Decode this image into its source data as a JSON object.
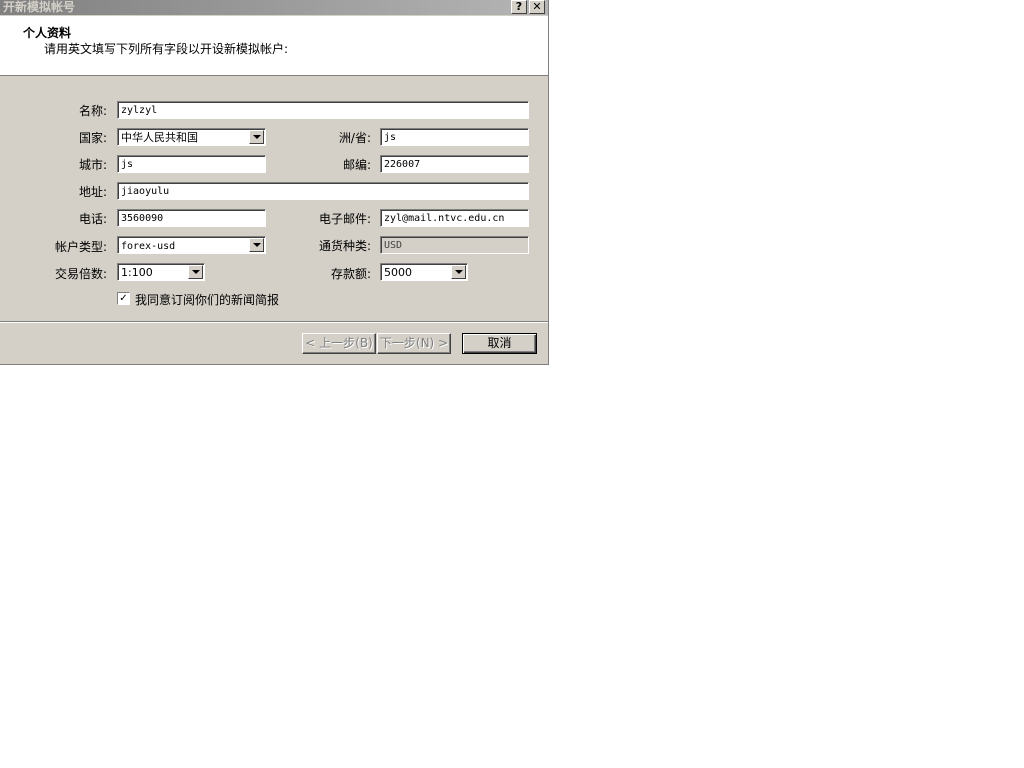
{
  "window": {
    "title": "开新模拟帐号",
    "help_label": "?",
    "close_label": "✕"
  },
  "header": {
    "title": "个人资料",
    "subtitle": "请用英文填写下列所有字段以开设新模拟帐户:"
  },
  "form": {
    "name": {
      "label": "名称:",
      "value": "zylzyl"
    },
    "country": {
      "label": "国家:",
      "value": "中华人民共和国"
    },
    "state": {
      "label": "洲/省:",
      "value": "js"
    },
    "city": {
      "label": "城市:",
      "value": "js"
    },
    "zip": {
      "label": "邮编:",
      "value": "226007"
    },
    "address": {
      "label": "地址:",
      "value": "jiaoyulu"
    },
    "phone": {
      "label": "电话:",
      "value": "3560090"
    },
    "email": {
      "label": "电子邮件:",
      "value": "zyl@mail.ntvc.edu.cn"
    },
    "account_type": {
      "label": "帐户类型:",
      "value": "forex-usd"
    },
    "currency": {
      "label": "通货种类:",
      "value": "USD"
    },
    "leverage": {
      "label": "交易倍数:",
      "value": "1:100"
    },
    "deposit": {
      "label": "存款额:",
      "value": "5000"
    },
    "newsletter": {
      "label": "我同意订阅你们的新闻简报",
      "mark": "✓"
    }
  },
  "buttons": {
    "back": "< 上一步(B)",
    "next": "下一步(N) >",
    "cancel": "取消"
  }
}
